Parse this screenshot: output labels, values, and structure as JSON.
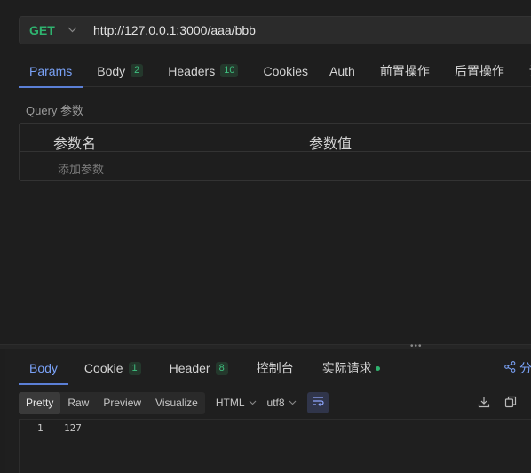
{
  "request": {
    "method": "GET",
    "url": "http://127.0.0.1:3000/aaa/bbb"
  },
  "request_tabs": [
    {
      "label": "Params",
      "badge": null,
      "active": true
    },
    {
      "label": "Body",
      "badge": "2"
    },
    {
      "label": "Headers",
      "badge": "10"
    },
    {
      "label": "Cookies",
      "badge": null
    },
    {
      "label": "Auth",
      "badge": null
    },
    {
      "label": "前置操作",
      "badge": null
    },
    {
      "label": "后置操作",
      "badge": null
    },
    {
      "label": "设",
      "badge": null
    }
  ],
  "params": {
    "section_title": "Query 参数",
    "columns": [
      "参数名",
      "参数值"
    ],
    "add_placeholder": "添加参数"
  },
  "response_tabs": [
    {
      "label": "Body",
      "badge": null,
      "active": true
    },
    {
      "label": "Cookie",
      "badge": "1"
    },
    {
      "label": "Header",
      "badge": "8"
    },
    {
      "label": "控制台",
      "badge": null
    },
    {
      "label": "实际请求",
      "badge": null,
      "status_dot": true
    }
  ],
  "share_label": "分",
  "view_modes": [
    "Pretty",
    "Raw",
    "Preview",
    "Visualize"
  ],
  "format_select": "HTML",
  "encoding_select": "utf8",
  "code": {
    "line_number": "1",
    "content": "127"
  },
  "splitter_dots": "•••",
  "colors": {
    "accent": "#7aa2f7",
    "method_get": "#2fb36f",
    "badge": "#3fbf7f"
  }
}
